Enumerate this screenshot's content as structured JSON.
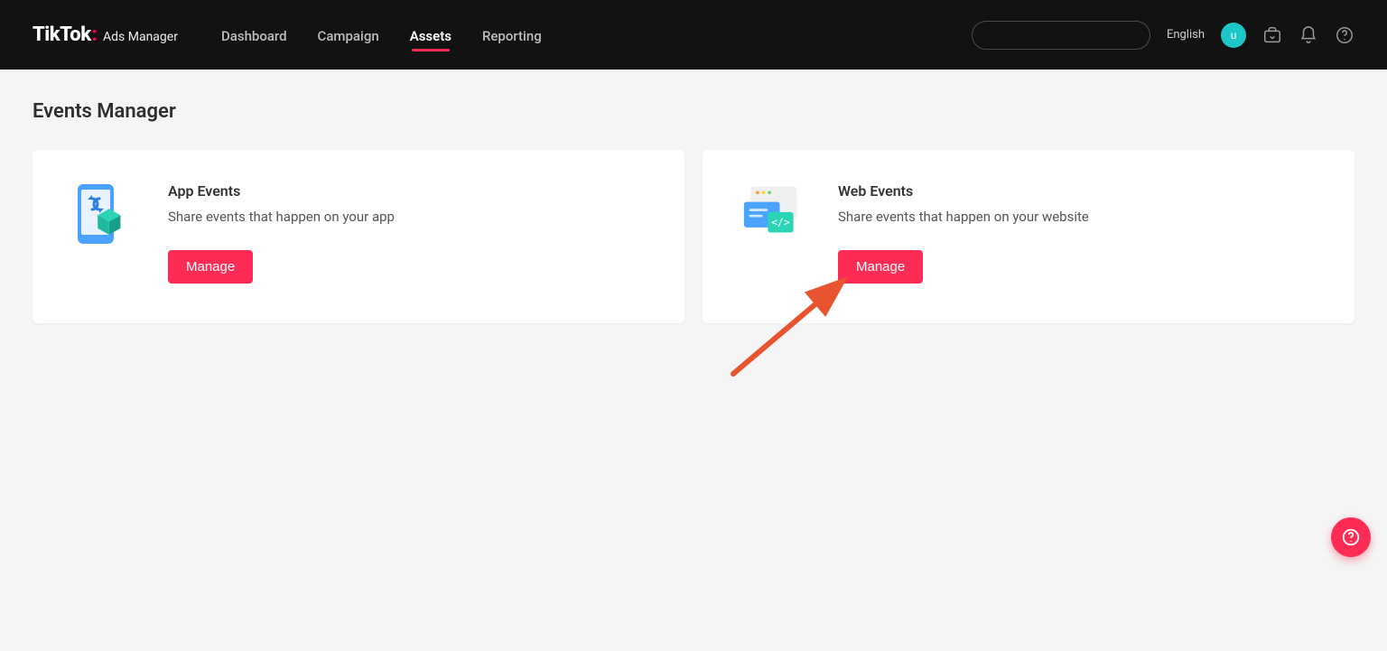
{
  "brand": {
    "main": "TikTok",
    "sub": "Ads Manager"
  },
  "nav": {
    "items": [
      {
        "label": "Dashboard"
      },
      {
        "label": "Campaign"
      },
      {
        "label": "Assets"
      },
      {
        "label": "Reporting"
      }
    ],
    "active_index": 2
  },
  "header": {
    "language": "English",
    "avatar_initial": "u"
  },
  "page": {
    "title": "Events Manager"
  },
  "cards": [
    {
      "title": "App Events",
      "description": "Share events that happen on your app",
      "button": "Manage"
    },
    {
      "title": "Web Events",
      "description": "Share events that happen on your website",
      "button": "Manage"
    }
  ],
  "colors": {
    "accent": "#fe2c55",
    "teal": "#1ec7c7",
    "header_bg": "#121212"
  }
}
